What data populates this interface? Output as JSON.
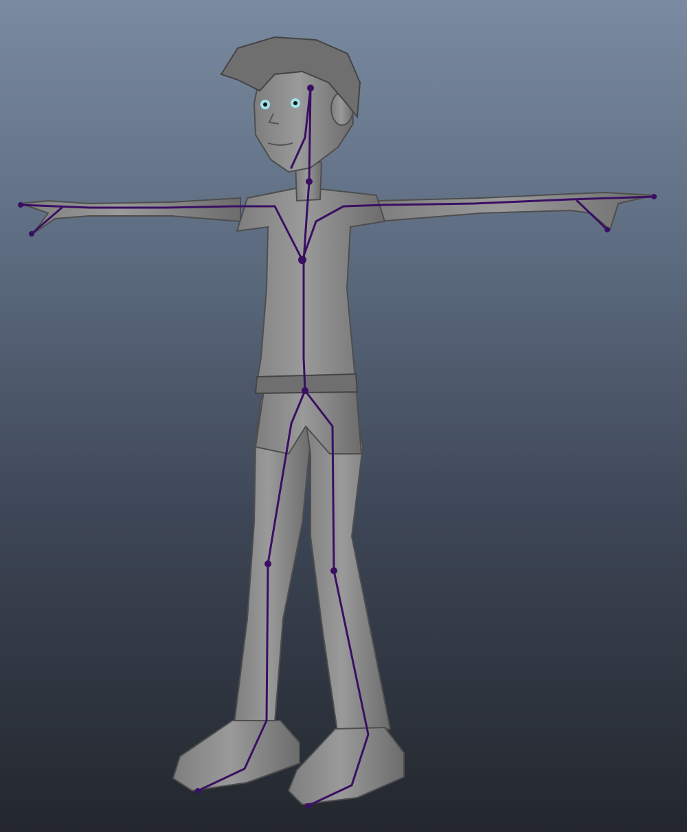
{
  "viewport": {
    "background_top": "#7a8aa0",
    "background_bottom": "#23272d",
    "mesh_color": "#8e8e8e",
    "skeleton_color": "#3a0f63"
  }
}
